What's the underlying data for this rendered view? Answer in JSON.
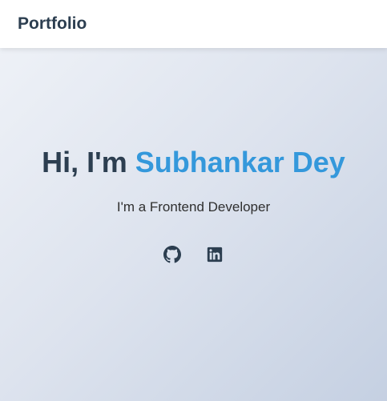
{
  "navbar": {
    "brand": "Portfolio"
  },
  "hero": {
    "greeting": "Hi, I'm ",
    "name": "Subhankar Dey",
    "tagline": "I'm a Frontend Developer"
  },
  "socials": [
    {
      "icon": "github-icon"
    },
    {
      "icon": "linkedin-icon"
    }
  ],
  "colors": {
    "text_dark": "#2c3e50",
    "accent": "#3498db"
  }
}
